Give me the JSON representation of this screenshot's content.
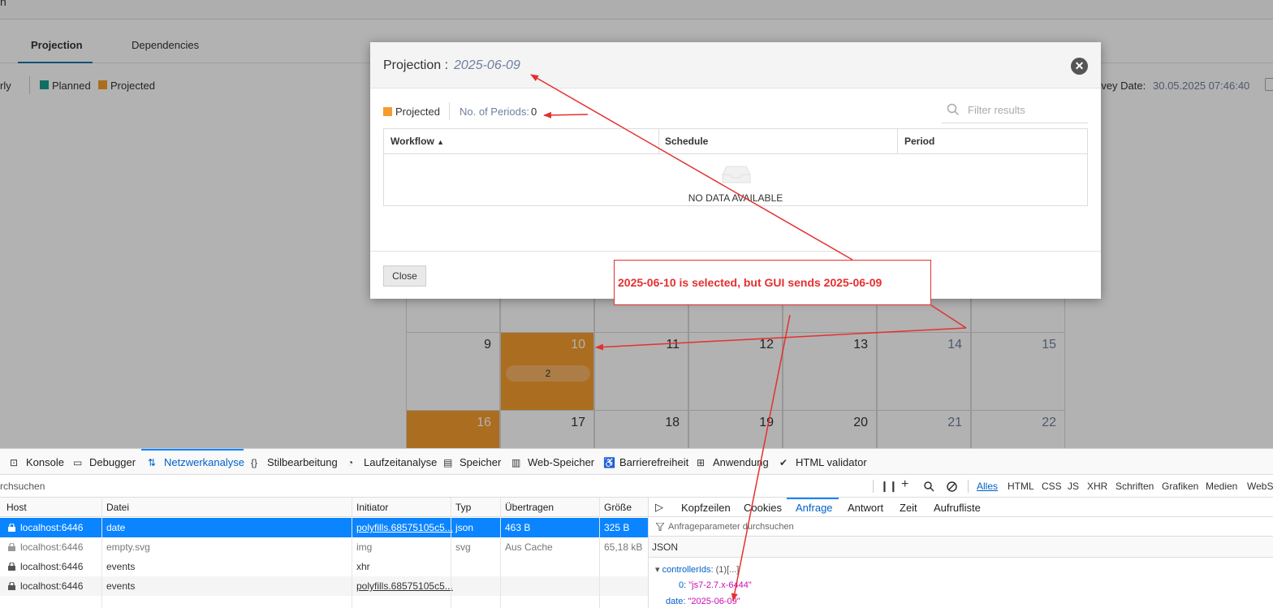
{
  "app": {
    "title_fragment": "n",
    "tabs": [
      {
        "label": "Projection",
        "active": true
      },
      {
        "label": "Dependencies",
        "active": false
      }
    ],
    "toolbar": {
      "partial_button": "rly",
      "legend": [
        {
          "label": "Planned",
          "color": "#1a9e8f"
        },
        {
          "label": "Projected",
          "color": "#f59c2d"
        }
      ],
      "survey_date_label": "rvey Date:",
      "survey_date_value": "30.05.2025 07:46:40"
    },
    "calendar": {
      "weeks": [
        {
          "days": [
            "9",
            "10",
            "11",
            "12",
            "13",
            "14",
            "15"
          ],
          "projected": [
            "10"
          ],
          "badge": {
            "day": "10",
            "count": "2"
          }
        },
        {
          "days": [
            "16",
            "17",
            "18",
            "19",
            "20",
            "21",
            "22"
          ],
          "projected": [
            "16"
          ]
        }
      ]
    }
  },
  "modal": {
    "title": "Projection :",
    "date": "2025-06-09",
    "legend_label": "Projected",
    "periods_label": "No. of Periods:",
    "periods_value": "0",
    "filter_placeholder": "Filter results",
    "columns": [
      "Workflow",
      "Schedule",
      "Period"
    ],
    "sort_indicator": "▲",
    "no_data": "NO DATA AVAILABLE",
    "close_label": "Close"
  },
  "annotation": {
    "text": "2025-06-10 is selected, but GUI sends 2025-06-09",
    "color": "#e53030"
  },
  "devtools": {
    "tabs": [
      {
        "label": "Konsole",
        "icon": "console-icon"
      },
      {
        "label": "Debugger",
        "icon": "debugger-icon"
      },
      {
        "label": "Netzwerkanalyse",
        "icon": "network-icon",
        "active": true
      },
      {
        "label": "Stilbearbeitung",
        "icon": "style-editor-icon"
      },
      {
        "label": "Laufzeitanalyse",
        "icon": "performance-icon"
      },
      {
        "label": "Speicher",
        "icon": "memory-icon"
      },
      {
        "label": "Web-Speicher",
        "icon": "storage-icon"
      },
      {
        "label": "Barrierefreiheit",
        "icon": "accessibility-icon"
      },
      {
        "label": "Anwendung",
        "icon": "application-icon"
      },
      {
        "label": "HTML validator",
        "icon": "validator-icon"
      }
    ],
    "filter_placeholder": "rchsuchen",
    "type_filters": [
      "Alles",
      "HTML",
      "CSS",
      "JS",
      "XHR",
      "Schriften",
      "Grafiken",
      "Medien",
      "WebSo"
    ],
    "columns": [
      "Host",
      "Datei",
      "Initiator",
      "Typ",
      "Übertragen",
      "Größe"
    ],
    "requests": [
      {
        "host": "localhost:6446",
        "file": "date",
        "initiator": "polyfills.68575105c5...",
        "type": "json",
        "transferred": "463 B",
        "size": "325 B"
      },
      {
        "host": "localhost:6446",
        "file": "empty.svg",
        "initiator": "img",
        "type": "svg",
        "transferred": "Aus Cache",
        "size": "65,18 kB"
      },
      {
        "host": "localhost:6446",
        "file": "events",
        "initiator": "xhr",
        "type": "",
        "transferred": "",
        "size": ""
      },
      {
        "host": "localhost:6446",
        "file": "events",
        "initiator": "polyfills.68575105c5...",
        "type": "",
        "transferred": "",
        "size": ""
      }
    ],
    "detail_tabs": [
      "Kopfzeilen",
      "Cookies",
      "Anfrage",
      "Antwort",
      "Zeit",
      "Aufrufliste"
    ],
    "active_detail_tab": "Anfrage",
    "params_filter_placeholder": "Anfrageparameter durchsuchen",
    "json_label": "JSON",
    "json": {
      "controller_key": "controllerIds:",
      "controller_summary": "(1)[...]",
      "item_index": "0:",
      "item_value": "\"js7-2.7.x-6444\"",
      "date_key": "date:",
      "date_value": "\"2025-06-09\""
    }
  }
}
